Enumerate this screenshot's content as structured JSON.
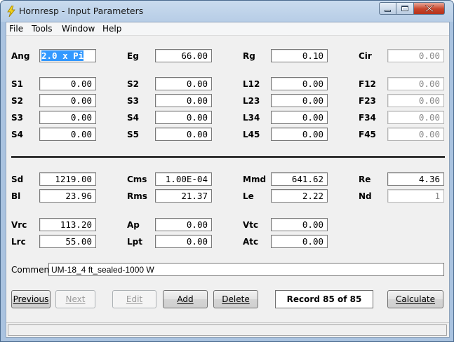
{
  "window": {
    "title": "Hornresp - Input Parameters"
  },
  "menu": [
    "File",
    "Tools",
    "Window",
    "Help"
  ],
  "fields": {
    "Ang": "2.0 x Pi",
    "Eg": "66.00",
    "Rg": "0.10",
    "Cir": "0.00",
    "S1": "0.00",
    "S2_col2": "0.00",
    "L12": "0.00",
    "F12": "0.00",
    "S2": "0.00",
    "S3_col2": "0.00",
    "L23": "0.00",
    "F23": "0.00",
    "S3": "0.00",
    "S4_col2": "0.00",
    "L34": "0.00",
    "F34": "0.00",
    "S4": "0.00",
    "S5": "0.00",
    "L45": "0.00",
    "F45": "0.00",
    "Sd": "1219.00",
    "Cms": "1.00E-04",
    "Mmd": "641.62",
    "Re": "4.36",
    "Bl": "23.96",
    "Rms": "21.37",
    "Le": "2.22",
    "Nd": "1",
    "Vrc": "113.20",
    "Ap": "0.00",
    "Vtc": "0.00",
    "Lrc": "55.00",
    "Lpt": "0.00",
    "Atc": "0.00"
  },
  "labels": {
    "Ang": "Ang",
    "Eg": "Eg",
    "Rg": "Rg",
    "Cir": "Cir",
    "S1": "S1",
    "S2c": "S2",
    "L12": "L12",
    "F12": "F12",
    "S2": "S2",
    "S3c": "S3",
    "L23": "L23",
    "F23": "F23",
    "S3": "S3",
    "S4c": "S4",
    "L34": "L34",
    "F34": "F34",
    "S4": "S4",
    "S5": "S5",
    "L45": "L45",
    "F45": "F45",
    "Sd": "Sd",
    "Cms": "Cms",
    "Mmd": "Mmd",
    "Re": "Re",
    "Bl": "Bl",
    "Rms": "Rms",
    "Le": "Le",
    "Nd": "Nd",
    "Vrc": "Vrc",
    "Ap": "Ap",
    "Vtc": "Vtc",
    "Lrc": "Lrc",
    "Lpt": "Lpt",
    "Atc": "Atc"
  },
  "comment": {
    "label": "Comment",
    "value": "UM-18_4 ft_sealed-1000 W"
  },
  "buttons": {
    "previous": "Previous",
    "next": "Next",
    "edit": "Edit",
    "add": "Add",
    "delete": "Delete",
    "calculate": "Calculate"
  },
  "record": "Record 85 of 85",
  "colors": {
    "selection": "#3399ff",
    "close_button": "#c7442b"
  }
}
